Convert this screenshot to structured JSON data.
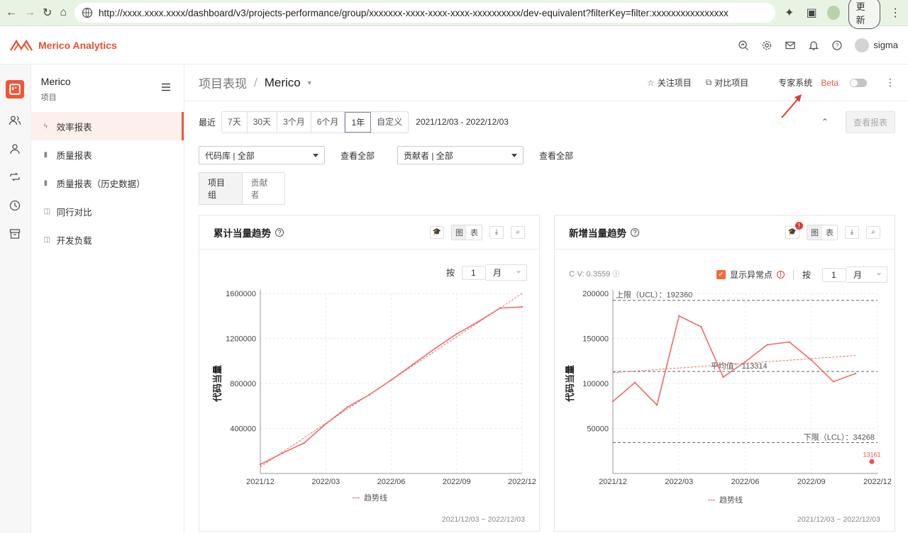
{
  "browser": {
    "url": "http://xxxx.xxxx.xxxx/dashboard/v3/projects-performance/group/xxxxxxx-xxxx-xxxx-xxxx-xxxxxxxxxx/dev-equivalent?filterKey=filter:xxxxxxxxxxxxxxxx",
    "update_label": "更新"
  },
  "topbar": {
    "brand": "Merico Analytics",
    "user": "sigma",
    "brand_color": "#e9502f"
  },
  "sidebar": {
    "title": "Merico",
    "subtitle": "项目",
    "items": [
      {
        "label": "效率报表",
        "active": true
      },
      {
        "label": "质量报表"
      },
      {
        "label": "质量报表（历史数据）"
      },
      {
        "label": "同行对比"
      },
      {
        "label": "开发负载"
      }
    ]
  },
  "header": {
    "breadcrumb_root": "项目表现",
    "breadcrumb_sep": "/",
    "project": "Merico",
    "follow": "关注项目",
    "compare": "对比项目",
    "expert": "专家系统",
    "beta": "Beta"
  },
  "filters": {
    "recent_label": "最近",
    "ranges": [
      "7天",
      "30天",
      "3个月",
      "6个月",
      "1年",
      "自定义"
    ],
    "selected_range": "1年",
    "date_range": "2021/12/03 - 2022/12/03",
    "view_report": "查看报表",
    "repo_select": "代码库 | 全部",
    "contributor_select": "贡献者 | 全部",
    "view_all_1": "查看全部",
    "view_all_2": "查看全部",
    "tabs": [
      "项目组",
      "贡献者"
    ]
  },
  "cards": [
    {
      "title": "累计当量趋势",
      "btn_chart": "图",
      "btn_table": "表",
      "per_label": "按",
      "per_num": "1",
      "per_unit": "月",
      "legend": "趋势线",
      "footer": "2021/12/03 ~ 2022/12/03"
    },
    {
      "title": "新增当量趋势",
      "btn_chart": "图",
      "btn_table": "表",
      "badge": "!",
      "per_label": "按",
      "per_num": "1",
      "per_unit": "月",
      "cv": "C·V: 0.3559",
      "anomaly_label": "显示异常点",
      "legend": "趋势线",
      "footer": "2021/12/03 ~ 2022/12/03"
    }
  ],
  "chart_data": [
    {
      "type": "line",
      "title": "累计当量趋势",
      "ylabel": "代码当量",
      "xlabel": "",
      "x_ticks": [
        "2021/12",
        "2022/03",
        "2022/06",
        "2022/09",
        "2022/12"
      ],
      "y_ticks": [
        400000,
        800000,
        1200000,
        1600000
      ],
      "ylim": [
        0,
        1600000
      ],
      "x": [
        0,
        1,
        2,
        3,
        4,
        5,
        6,
        7,
        8,
        9,
        10,
        11,
        12
      ],
      "series": [
        {
          "values": [
            80000,
            180000,
            270000,
            440000,
            590000,
            700000,
            830000,
            970000,
            1110000,
            1240000,
            1350000,
            1470000,
            1480000
          ]
        }
      ],
      "trend": {
        "name": "趋势线",
        "from": 60000,
        "to": 1600000
      },
      "grid": true,
      "color": "#ee6b6b"
    },
    {
      "type": "line",
      "title": "新增当量趋势",
      "ylabel": "代码当量",
      "xlabel": "",
      "x_ticks": [
        "2021/12",
        "2022/03",
        "2022/06",
        "2022/09",
        "2022/12"
      ],
      "y_ticks": [
        50000,
        100000,
        150000,
        200000
      ],
      "ylim": [
        0,
        200000
      ],
      "x": [
        0,
        1,
        2,
        3,
        4,
        5,
        6,
        7,
        8,
        9,
        10,
        11
      ],
      "series": [
        {
          "values": [
            80000,
            101000,
            76000,
            175000,
            163000,
            107000,
            124000,
            143000,
            146000,
            126000,
            102000,
            111000
          ]
        }
      ],
      "anomaly": {
        "x": 12,
        "value": 13161,
        "label": "13161"
      },
      "ucl": {
        "value": 192360,
        "label": "上限（UCL）：192360"
      },
      "mean": {
        "value": 113314,
        "label": "平均值：113314"
      },
      "lcl": {
        "value": 34268,
        "label": "下限（LCL）：34268"
      },
      "trend": {
        "name": "趋势线",
        "from": 112000,
        "to": 131000
      },
      "grid": true,
      "color": "#ee6b6b"
    }
  ]
}
